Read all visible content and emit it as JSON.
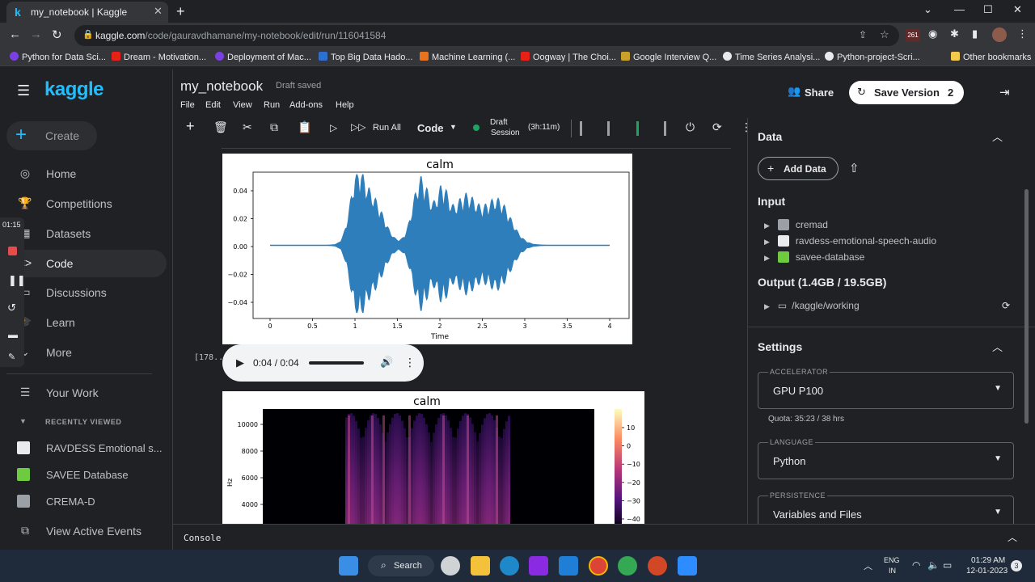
{
  "browser": {
    "tab_title": "my_notebook | Kaggle",
    "tab_favicon": "k",
    "url_host": "kaggle.com",
    "url_path": "/code/gauravdhamane/my-notebook/edit/run/116041584",
    "bookmarks": [
      "Python for Data Sci...",
      "Dream - Motivation...",
      "Deployment of Mac...",
      "Top Big Data Hado...",
      "Machine Learning (...",
      "Oogway | The Choi...",
      "Google Interview Q...",
      "Time Series Analysi...",
      "Python-project-Scri..."
    ],
    "other_bookmarks": "Other bookmarks",
    "ext_badge": "261"
  },
  "sidebar": {
    "logo": "kaggle",
    "create": "Create",
    "items": [
      {
        "label": "Home",
        "icon": "compass-icon"
      },
      {
        "label": "Competitions",
        "icon": "trophy-icon"
      },
      {
        "label": "Datasets",
        "icon": "table-icon"
      },
      {
        "label": "Code",
        "icon": "code-icon"
      },
      {
        "label": "Discussions",
        "icon": "comments-icon"
      },
      {
        "label": "Learn",
        "icon": "school-icon"
      },
      {
        "label": "More",
        "icon": "expand-icon"
      }
    ],
    "your_work": "Your Work",
    "recently_viewed": "RECENTLY VIEWED",
    "recent": [
      "RAVDESS Emotional s...",
      "SAVEE Database",
      "CREMA-D"
    ],
    "view_active_events": "View Active Events",
    "recorder_time": "01:15"
  },
  "notebook": {
    "title": "my_notebook",
    "status": "Draft saved",
    "menu": [
      "File",
      "Edit",
      "View",
      "Run",
      "Add-ons",
      "Help"
    ],
    "share": "Share",
    "save_version": "Save Version",
    "save_count": "2",
    "run_all": "Run All",
    "cell_type": "Code",
    "session_line1": "Draft",
    "session_line2": "Session",
    "session_time": "(3h:11m)",
    "meters": [
      "H\nD\nD",
      "C\nP\nU",
      "R\nA\nM",
      "G\nP\nU"
    ],
    "cell_label": "[178...",
    "audio_time": "0:04 / 0:04"
  },
  "waveform": {
    "title": "calm",
    "xlabel": "Time",
    "xticks": [
      "0",
      "0.5",
      "1",
      "1.5",
      "2",
      "2.5",
      "3",
      "3.5",
      "4"
    ],
    "yticks": [
      "0.04",
      "0.02",
      "0.00",
      "−0.02",
      "−0.04"
    ],
    "color": "#2f7ebc"
  },
  "spectrogram": {
    "title": "calm",
    "ylabel": "Hz",
    "yticks": [
      "10000",
      "8000",
      "6000",
      "4000"
    ],
    "cbar_ticks": [
      "10",
      "0",
      "−10",
      "−20",
      "−30",
      "−40"
    ]
  },
  "right_panel": {
    "data_h": "Data",
    "add_data": "Add Data",
    "input_h": "Input",
    "inputs": [
      "cremad",
      "ravdess-emotional-speech-audio",
      "savee-database"
    ],
    "output_h": "Output (1.4GB / 19.5GB)",
    "output_path": "/kaggle/working",
    "settings_h": "Settings",
    "accel_label": "ACCELERATOR",
    "accel_value": "GPU P100",
    "quota": "Quota: 35:23 / 38 hrs",
    "lang_label": "LANGUAGE",
    "lang_value": "Python",
    "persist_label": "PERSISTENCE",
    "persist_value": "Variables and Files"
  },
  "console": "Console",
  "taskbar": {
    "search": "Search",
    "lang1": "ENG",
    "lang2": "IN",
    "time": "01:29 AM",
    "date": "12-01-2023",
    "notif": "3"
  },
  "colors": {
    "kaggle_blue": "#20beff",
    "accent": "#20beff",
    "session_dot": "#1ea362"
  }
}
